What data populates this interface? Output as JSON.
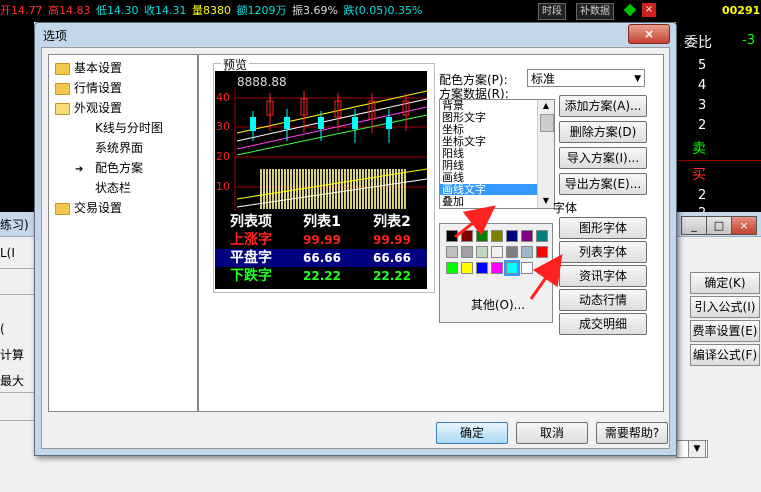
{
  "ticker": {
    "open": "开14.77",
    "high": "高14.83",
    "low": "低14.30",
    "close": "收14.31",
    "volume": "量8380",
    "amount": "额1209万",
    "amplitude": "振3.69%",
    "change": "跌(0.05)0.35%",
    "btn_period": "时段",
    "btn_supplement": "补数据",
    "code": "00291"
  },
  "right_panel": {
    "label_weibi": "委比",
    "weibi_value": "-3",
    "nums": [
      "5",
      "4",
      "3",
      "2"
    ],
    "sell": "卖",
    "buy": "买",
    "buy_nums": [
      "2",
      "2"
    ]
  },
  "background": {
    "left_labels": [
      "练习)",
      "L(I",
      "(",
      "计算",
      "最大"
    ],
    "buttons": [
      "确定(K)",
      "引入公式(I)",
      "费率设置(E)",
      "编译公式(F)"
    ],
    "win_buttons": [
      "_",
      "□",
      "×"
    ]
  },
  "dialog": {
    "title": "选项",
    "close": "×",
    "tree": [
      {
        "label": "基本设置",
        "folder": true
      },
      {
        "label": "行情设置",
        "folder": true
      },
      {
        "label": "外观设置",
        "folder": true
      },
      {
        "label": "K线与分时图",
        "folder": false
      },
      {
        "label": "系统界面",
        "folder": false
      },
      {
        "label": "配色方案",
        "folder": false
      },
      {
        "label": "状态栏",
        "folder": false
      },
      {
        "label": "交易设置",
        "folder": true
      }
    ],
    "preview_label": "预览",
    "preview_price": "8888.88",
    "y_ticks": [
      "40",
      "30",
      "20",
      "10"
    ],
    "table": {
      "headers": [
        "列表项",
        "列表1",
        "列表2"
      ],
      "rows": [
        {
          "name": "上涨字",
          "v1": "99.99",
          "v2": "99.99",
          "color": "#ff2020"
        },
        {
          "name": "平盘字",
          "v1": "66.66",
          "v2": "66.66",
          "color": "#ffffff"
        },
        {
          "name": "下跌字",
          "v1": "22.22",
          "v2": "22.22",
          "color": "#20ff20"
        }
      ]
    },
    "scheme_label": "配色方案(P):",
    "scheme_value": "标准",
    "data_label": "方案数据(R):",
    "data_items": [
      "背景",
      "图形文字",
      "坐标",
      "坐标文字",
      "阳线",
      "阴线",
      "画线",
      "画线文字",
      "叠加"
    ],
    "data_selected": "画线文字",
    "scheme_buttons": [
      "添加方案(A)...",
      "删除方案(D)",
      "导入方案(I)...",
      "导出方案(E)..."
    ],
    "other_button": "其他(O)...",
    "font_label": "字体",
    "font_buttons": [
      "图形字体",
      "列表字体",
      "资讯字体",
      "动态行情",
      "成交明细"
    ],
    "ok": "确定",
    "cancel": "取消",
    "help": "需要帮助?",
    "colors": {
      "accent_red": "#ff0000",
      "panel_bg": "#000000",
      "selected_bg": "#3399ff"
    },
    "palette_rows": [
      [
        "#000000",
        "#800000",
        "#008000",
        "#808000",
        "#000080",
        "#800080",
        "#008080"
      ],
      [
        "#c0c0c0",
        "#a0a0a0",
        "#c0d8c0",
        "#f0f0f0",
        "#808080",
        "#a0b8c8",
        "#ff0000"
      ],
      [
        "#00ff00",
        "#ffff00",
        "#0000ff",
        "#ff00ff",
        "#00ffff",
        "#ffffff"
      ]
    ]
  }
}
